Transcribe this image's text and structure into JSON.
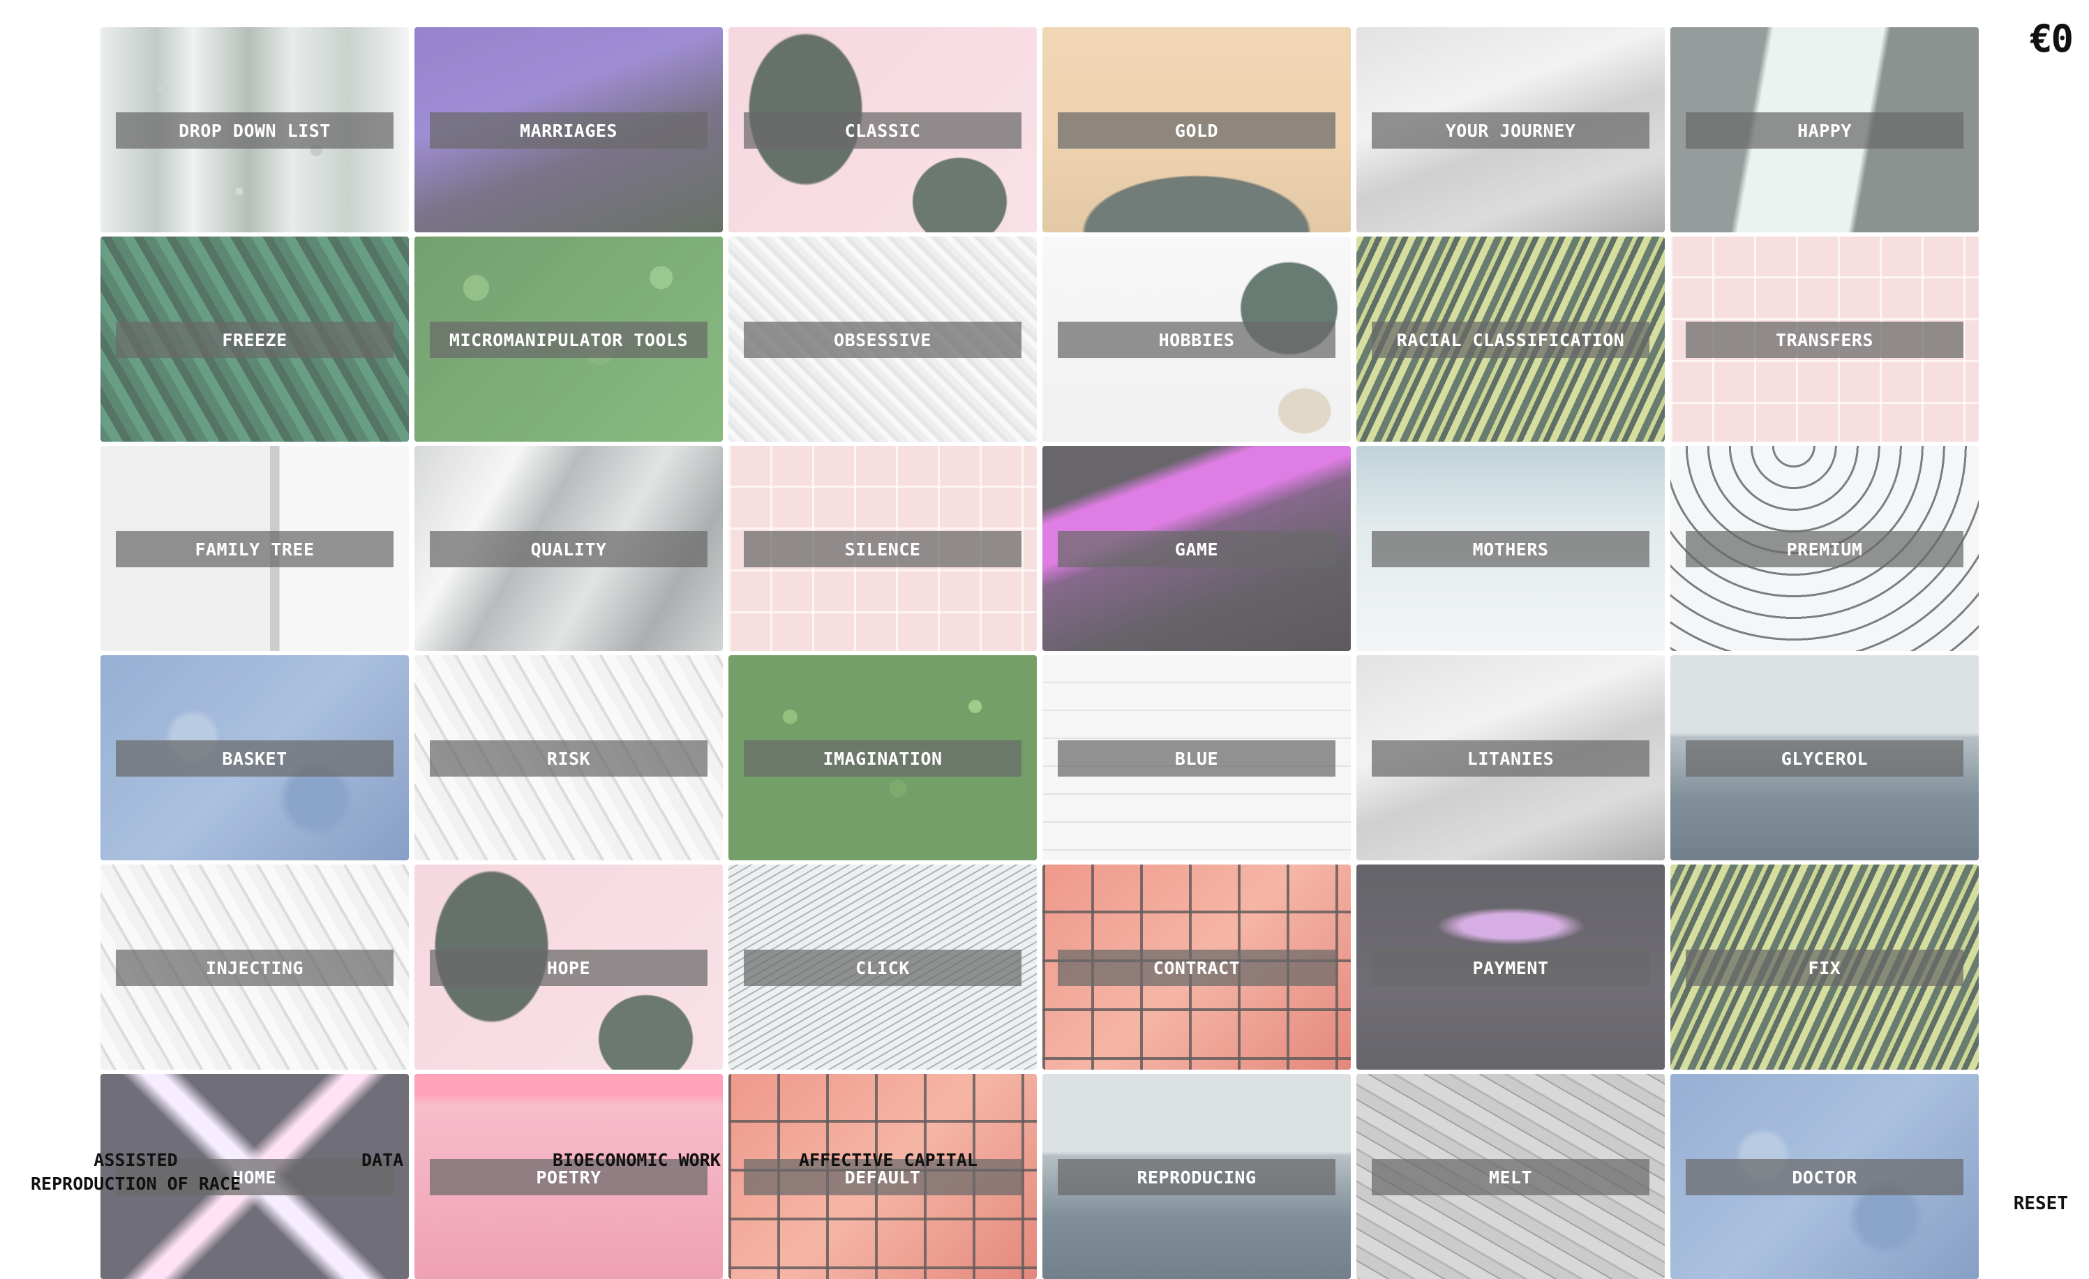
{
  "balance": "€0",
  "reset_label": "RESET",
  "footer": {
    "assisted_line1": "ASSISTED",
    "assisted_line2": "REPRODUCTION OF RACE",
    "data": "DATA",
    "bioeconomic": "BIOECONOMIC WORK",
    "affective": "AFFECTIVE CAPITAL"
  },
  "tiles": [
    {
      "label": "DROP DOWN LIST",
      "theme": "rain"
    },
    {
      "label": "MARRIAGES",
      "theme": "purple-leaves"
    },
    {
      "label": "CLASSIC",
      "theme": "pink-plant"
    },
    {
      "label": "GOLD",
      "theme": "gold"
    },
    {
      "label": "YOUR JOURNEY",
      "theme": "grey-rail"
    },
    {
      "label": "HAPPY",
      "theme": "architecture"
    },
    {
      "label": "FREEZE",
      "theme": "green-leaves"
    },
    {
      "label": "MICROMANIPULATOR TOOLS",
      "theme": "clover"
    },
    {
      "label": "OBSESSIVE",
      "theme": "feathers"
    },
    {
      "label": "HOBBIES",
      "theme": "white-plant"
    },
    {
      "label": "RACIAL CLASSIFICATION",
      "theme": "palm-leaf"
    },
    {
      "label": "TRANSFERS",
      "theme": "pink-tiles"
    },
    {
      "label": "FAMILY TREE",
      "theme": "window"
    },
    {
      "label": "QUALITY",
      "theme": "grey-shadow"
    },
    {
      "label": "SILENCE",
      "theme": "pink-tiles"
    },
    {
      "label": "GAME",
      "theme": "neon-room"
    },
    {
      "label": "MOTHERS",
      "theme": "frost"
    },
    {
      "label": "PREMIUM",
      "theme": "dome"
    },
    {
      "label": "BASKET",
      "theme": "blue-ice"
    },
    {
      "label": "RISK",
      "theme": "white-pattern"
    },
    {
      "label": "IMAGINATION",
      "theme": "hedge"
    },
    {
      "label": "BLUE",
      "theme": "white-bricks"
    },
    {
      "label": "LITANIES",
      "theme": "grey-rail"
    },
    {
      "label": "GLYCEROL",
      "theme": "sea"
    },
    {
      "label": "INJECTING",
      "theme": "white-pattern"
    },
    {
      "label": "HOPE",
      "theme": "pink-plant"
    },
    {
      "label": "CLICK",
      "theme": "glass-roof"
    },
    {
      "label": "CONTRACT",
      "theme": "red-windows"
    },
    {
      "label": "PAYMENT",
      "theme": "dark-neon"
    },
    {
      "label": "FIX",
      "theme": "palm-leaf"
    },
    {
      "label": "HOME",
      "theme": "neon-x"
    },
    {
      "label": "POETRY",
      "theme": "pink-neon"
    },
    {
      "label": "DEFAULT",
      "theme": "red-windows"
    },
    {
      "label": "REPRODUCING",
      "theme": "sea"
    },
    {
      "label": "MELT",
      "theme": "marble"
    },
    {
      "label": "DOCTOR",
      "theme": "blue-ice"
    }
  ]
}
